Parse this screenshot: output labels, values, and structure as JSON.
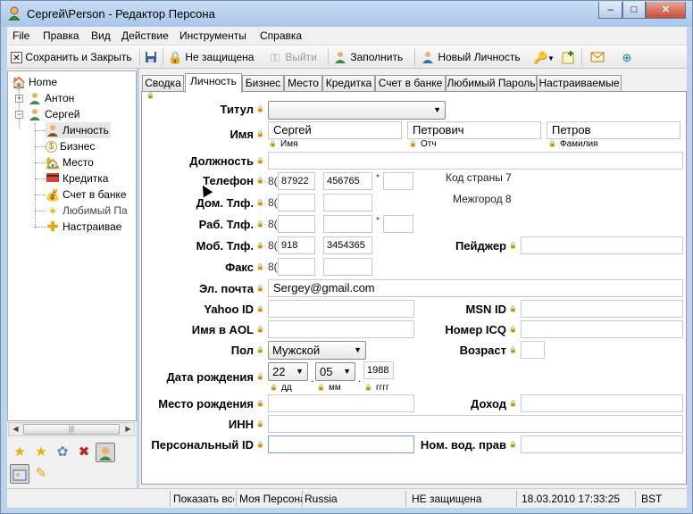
{
  "window": {
    "title": "Сергей\\Person - Редактор Персона",
    "minimize": "–",
    "maximize": "□",
    "close": "✕"
  },
  "menu": [
    "File",
    "Правка",
    "Вид",
    "Действие",
    "Инструменты",
    "Справка"
  ],
  "toolbar": {
    "save_close": "Сохранить и Закрыть",
    "unprotected": "Не защищена",
    "exit": "Выйти",
    "fill": "Заполнить",
    "new_person": "Новый Личность"
  },
  "tree": {
    "home": "Home",
    "anton": "Антон",
    "sergey": "Сергей",
    "items": [
      "Личность",
      "Бизнес",
      "Место",
      "Кредитка",
      "Счет в банке",
      "Любимый Па",
      "Настраивае"
    ]
  },
  "tabs": [
    "Сводка",
    "Личность",
    "Бизнес",
    "Место",
    "Кредитка",
    "Счет в банке",
    "Любимый Пароль",
    "Настраиваемые"
  ],
  "form": {
    "title_label": "Титул",
    "title_value": "",
    "name_label": "Имя",
    "first_name": "Сергей",
    "middle_name": "Петрович",
    "last_name": "Петров",
    "first_name_sub": "Имя",
    "middle_name_sub": "Отч",
    "last_name_sub": "Фамилия",
    "position_label": "Должность",
    "phone_label": "Телефон",
    "phone_prefix": "8(",
    "phone_code": "87922",
    "phone_number": "456765",
    "phone_star": "*",
    "country_code": "Код страны 7",
    "intercity": "Межгород 8",
    "home_phone_label": "Дом. Тлф.",
    "work_phone_label": "Раб. Тлф.",
    "mobile_label": "Моб. Тлф.",
    "mobile_code": "918",
    "mobile_number": "3454365",
    "pager_label": "Пейджер",
    "fax_label": "Факс",
    "email_label": "Эл. почта",
    "email_value": "Sergey@gmail.com",
    "yahoo_label": "Yahoo ID",
    "msn_label": "MSN ID",
    "aol_label": "Имя в AOL",
    "icq_label": "Номер ICQ",
    "gender_label": "Пол",
    "gender_value": "Мужской",
    "age_label": "Возраст",
    "birth_label": "Дата рождения",
    "birth_day": "22",
    "birth_month": "05",
    "birth_year": "1988",
    "day_sub": "дд",
    "month_sub": "мм",
    "year_sub": "гггг",
    "dot": ".",
    "birthplace_label": "Место рождения",
    "income_label": "Доход",
    "inn_label": "ИНН",
    "personal_id_label": "Персональный ID",
    "license_label": "Ном. вод. прав"
  },
  "status": {
    "show": "Показать все",
    "my_person": "Моя Персона",
    "country": "Russia",
    "protection": "НЕ защищена",
    "datetime": "18.03.2010 17:33:25",
    "dst": "BST"
  }
}
